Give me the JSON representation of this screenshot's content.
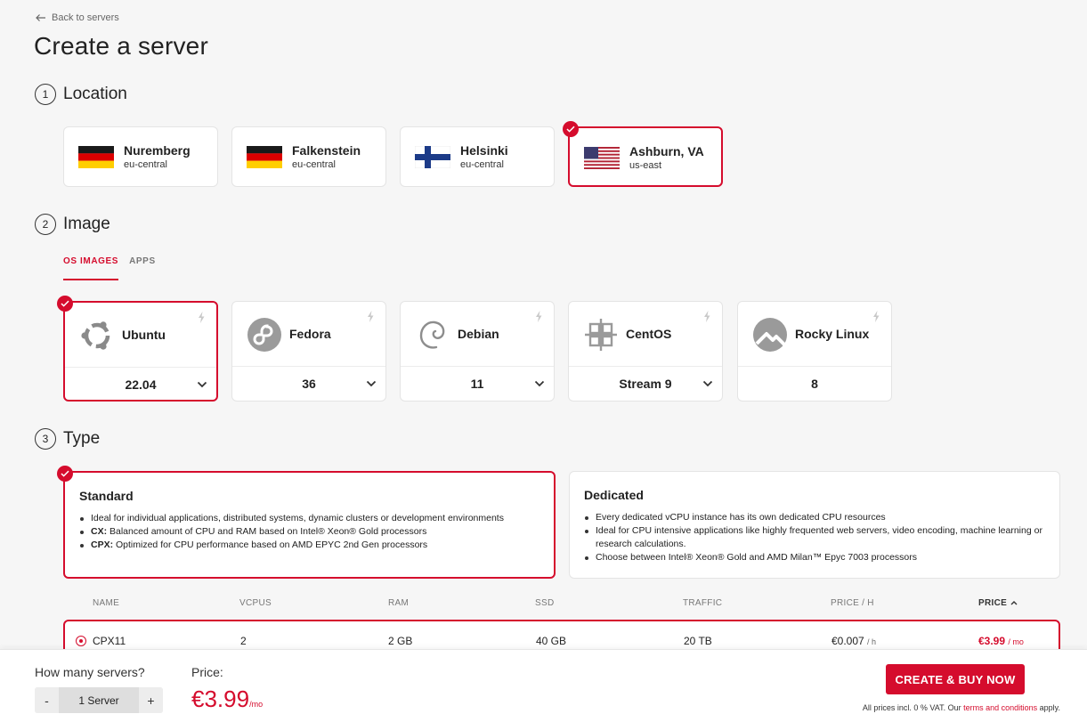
{
  "nav": {
    "back_label": "Back to servers"
  },
  "page_title": "Create a server",
  "location": {
    "step": "1",
    "title": "Location",
    "options": [
      {
        "name": "Nuremberg",
        "zone": "eu-central",
        "flag": "germany-flag"
      },
      {
        "name": "Falkenstein",
        "zone": "eu-central",
        "flag": "germany-flag"
      },
      {
        "name": "Helsinki",
        "zone": "eu-central",
        "flag": "finland-flag"
      },
      {
        "name": "Ashburn, VA",
        "zone": "us-east",
        "flag": "usa-flag"
      }
    ],
    "selected": "Ashburn, VA"
  },
  "image": {
    "step": "2",
    "title": "Image",
    "tabs": [
      "OS IMAGES",
      "APPS"
    ],
    "active_tab": "OS IMAGES",
    "options": [
      {
        "name": "Ubuntu",
        "version": "22.04",
        "icon": "ubuntu-icon"
      },
      {
        "name": "Fedora",
        "version": "36",
        "icon": "fedora-icon"
      },
      {
        "name": "Debian",
        "version": "11",
        "icon": "debian-icon"
      },
      {
        "name": "CentOS",
        "version": "Stream 9",
        "icon": "centos-icon"
      },
      {
        "name": "Rocky Linux",
        "version": "8",
        "icon": "rocky-linux-icon"
      }
    ],
    "selected": "Ubuntu"
  },
  "type": {
    "step": "3",
    "title": "Type",
    "standard": {
      "title": "Standard",
      "bullets": [
        {
          "prefix": "",
          "text": "Ideal for individual applications, distributed systems, dynamic clusters or development environments"
        },
        {
          "prefix": "CX:",
          "text": " Balanced amount of CPU and RAM based on Intel® Xeon® Gold processors"
        },
        {
          "prefix": "CPX:",
          "text": " Optimized for CPU performance based on AMD EPYC 2nd Gen processors"
        }
      ]
    },
    "dedicated": {
      "title": "Dedicated",
      "bullets": [
        "Every dedicated vCPU instance has its own dedicated CPU resources",
        "Ideal for CPU intensive applications like highly frequented web servers, video encoding, machine learning or research calculations.",
        "Choose between Intel® Xeon® Gold and AMD Milan™ Epyc 7003 processors"
      ]
    },
    "selected": "Standard",
    "table": {
      "headers": [
        "NAME",
        "VCPUS",
        "RAM",
        "SSD",
        "TRAFFIC",
        "PRICE / H",
        "PRICE"
      ],
      "sort_indicator": "^",
      "rows": [
        {
          "name": "CPX11",
          "vcpus": "2",
          "ram": "2 GB",
          "ssd": "40 GB",
          "traffic": "20 TB",
          "price_h": "€0.007",
          "price_h_unit": "/ h",
          "price": "€3.99",
          "price_unit": "/ mo"
        }
      ]
    }
  },
  "footer": {
    "count_label": "How many servers?",
    "minus": "-",
    "count_value": "1 Server",
    "plus": "+",
    "price_label": "Price:",
    "price_value": "€3.99",
    "price_unit": "/mo",
    "buy_label": "CREATE & BUY NOW",
    "vat_prefix": "All prices incl. 0 % VAT. Our ",
    "vat_link": "terms and conditions",
    "vat_suffix": " apply."
  },
  "colors": {
    "accent": "#d50c2d",
    "background": "#f6f6f6",
    "card": "#ffffff"
  }
}
